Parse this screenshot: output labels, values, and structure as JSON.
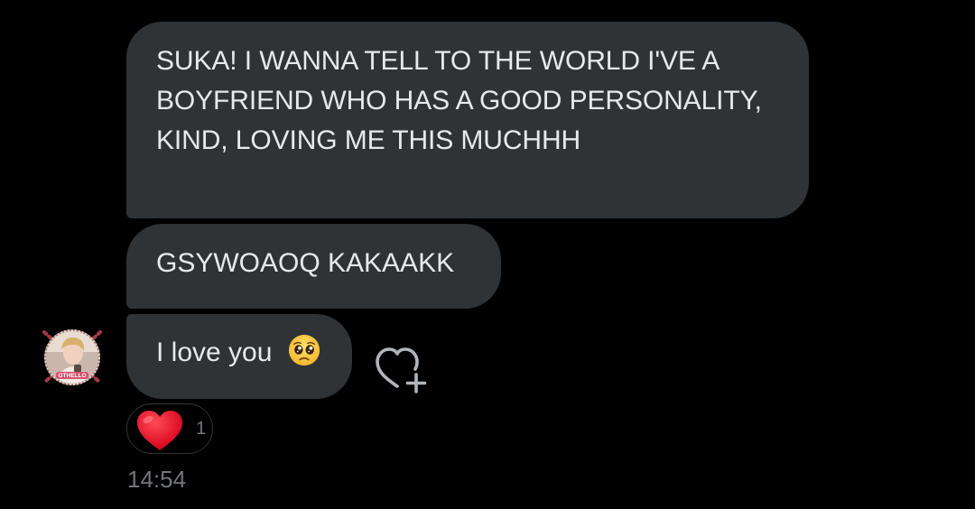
{
  "messages": [
    {
      "text": "SUKA! I WANNA TELL TO THE WORLD I'VE A BOYFRIEND WHO HAS A GOOD PERSONALITY, KIND, LOVING ME THIS MUCHHH"
    },
    {
      "text": "GSYWOAOQ KAKAAKK"
    },
    {
      "text": "I love you",
      "emoji": "pleading-face"
    }
  ],
  "avatar": {
    "badge_text": "OTHELLO"
  },
  "reaction": {
    "emoji": "red-heart",
    "count": "1"
  },
  "timestamp": "14:54",
  "colors": {
    "background": "#000000",
    "bubble": "#2f3336",
    "text": "#e7e9ea",
    "muted": "#71767b",
    "heart": "#f91880"
  }
}
